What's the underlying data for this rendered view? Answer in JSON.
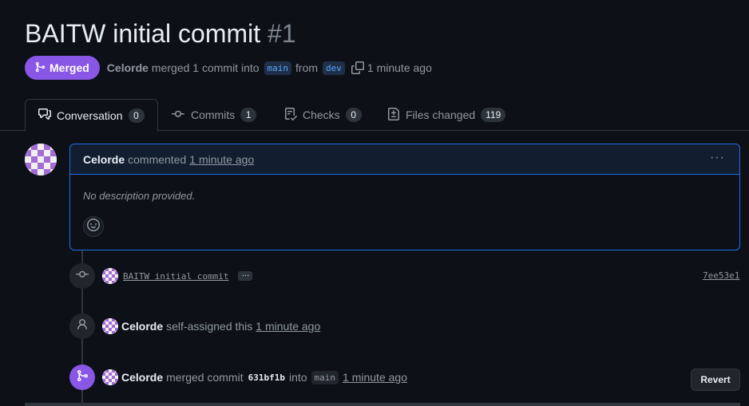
{
  "pr": {
    "title": "BAITW initial commit",
    "number": "#1",
    "state_label": "Merged",
    "author": "Celorde",
    "merged_text": "merged 1 commit into",
    "base_branch": "main",
    "from_text": "from",
    "head_branch": "dev",
    "time": "1 minute ago"
  },
  "tabs": [
    {
      "label": "Conversation",
      "count": "0",
      "icon": "comment-discussion-icon"
    },
    {
      "label": "Commits",
      "count": "1",
      "icon": "git-commit-icon"
    },
    {
      "label": "Checks",
      "count": "0",
      "icon": "checklist-icon"
    },
    {
      "label": "Files changed",
      "count": "119",
      "icon": "file-diff-icon"
    }
  ],
  "comment": {
    "author": "Celorde",
    "action": "commented",
    "time": "1 minute ago",
    "body": "No description provided.",
    "menu": "···"
  },
  "timeline": {
    "commit": {
      "message": "BAITW initial commit",
      "ellipsis": "…",
      "sha": "7ee53e1"
    },
    "assign": {
      "author": "Celorde",
      "action": "self-assigned this",
      "time": "1 minute ago"
    },
    "merge": {
      "author": "Celorde",
      "action": "merged commit",
      "sha": "631bf1b",
      "into": "into",
      "branch": "main",
      "time": "1 minute ago",
      "revert_label": "Revert"
    }
  },
  "colors": {
    "accent_merged": "#8957e5",
    "link_blue": "#58a6ff",
    "border_focus": "#1f6feb",
    "background": "#0d1117"
  }
}
